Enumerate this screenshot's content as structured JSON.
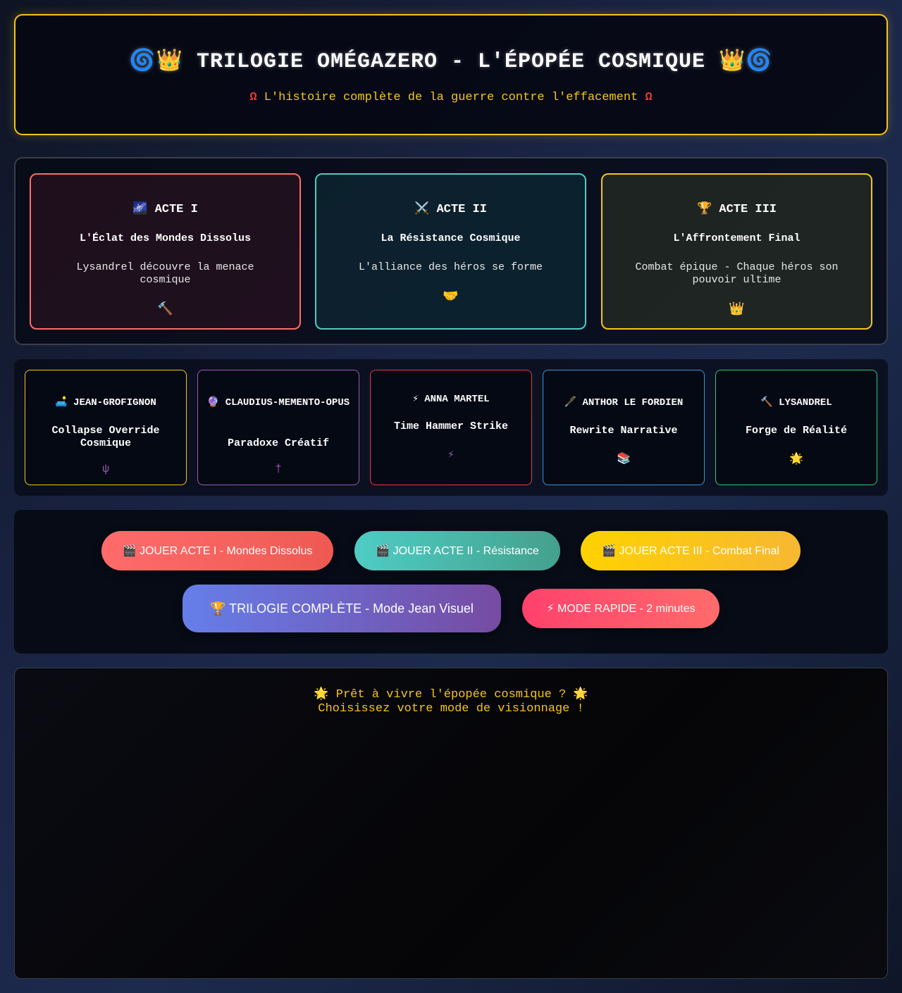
{
  "header": {
    "title": "🌀👑 TRILOGIE OMÉGAZERO - L'ÉPOPÉE COSMIQUE 👑🌀",
    "omega_symbol": "Ω",
    "subtitle": "L'histoire complète de la guerre contre l'effacement"
  },
  "acts": [
    {
      "title": "🌌 ACTE I",
      "subtitle": "L'Éclat des Mondes Dissolus",
      "description": "Lysandrel découvre la menace cosmique",
      "icon": "🔨",
      "color": "#ff6b6b"
    },
    {
      "title": "⚔️ ACTE II",
      "subtitle": "La Résistance Cosmique",
      "description": "L'alliance des héros se forme",
      "icon": "🤝",
      "color": "#4ecdc4"
    },
    {
      "title": "🏆 ACTE III",
      "subtitle": "L'Affrontement Final",
      "description": "Combat épique - Chaque héros son pouvoir ultime",
      "icon": "👑",
      "color": "#f5c518"
    }
  ],
  "heroes": [
    {
      "name": "🛋️ JEAN-GROFIGNON",
      "power": "Collapse Override Cosmique",
      "icon": "ψ",
      "color": "#f5c518"
    },
    {
      "name": "🔮 CLAUDIUS-MEMENTO-OPUS",
      "power": "Paradoxe Créatif",
      "icon": "†",
      "color": "#9b59b6"
    },
    {
      "name": "⚡ ANNA MARTEL",
      "power": "Time Hammer Strike",
      "icon": "⚡",
      "color": "#e53945"
    },
    {
      "name": "🖋️ ANTHOR LE FORDIEN",
      "power": "Rewrite Narrative",
      "icon": "📚",
      "color": "#3498db"
    },
    {
      "name": "🔨 LYSANDREL",
      "power": "Forge de Réalité",
      "icon": "🌟",
      "color": "#2ecc71"
    }
  ],
  "buttons": {
    "play_act1": "🎬 JOUER ACTE I - Mondes Dissolus",
    "play_act2": "🎬 JOUER ACTE II - Résistance",
    "play_act3": "🎬 JOUER ACTE III - Combat Final",
    "full_trilogy": "🏆 TRILOGIE COMPLÈTE - Mode Jean Visuel",
    "quick_mode": "⚡ MODE RAPIDE - 2 minutes"
  },
  "output": {
    "line1": "🌟 Prêt à vivre l'épopée cosmique ? 🌟",
    "line2": "Choisissez votre mode de visionnage !"
  }
}
